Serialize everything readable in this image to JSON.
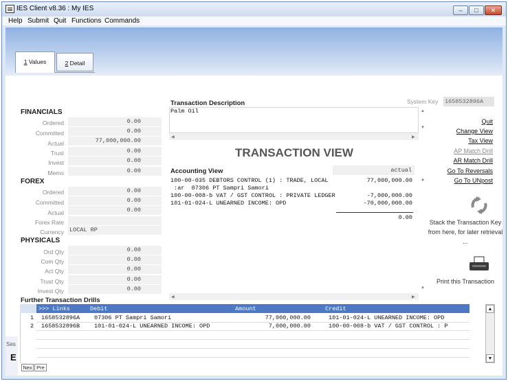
{
  "window": {
    "title": "IES Client v8.36 : My IES"
  },
  "menu": [
    "Help",
    "Submit",
    "Quit",
    "Functions",
    "Commands"
  ],
  "tabs": [
    {
      "label": "1 Values",
      "key": "1",
      "rest": " Values"
    },
    {
      "label": "2 Detail",
      "key": "2",
      "rest": " Detail"
    }
  ],
  "financials": {
    "heading": "FINANCIALS",
    "rows": [
      {
        "label": "Ordered",
        "value": "0.00"
      },
      {
        "label": "Committed",
        "value": "0.00"
      },
      {
        "label": "Actual",
        "value": "77,000,000.00"
      },
      {
        "label": "Trust",
        "value": "0.00"
      },
      {
        "label": "Invest",
        "value": "0.00"
      },
      {
        "label": "Memo",
        "value": "0.00"
      }
    ]
  },
  "forex": {
    "heading": "FOREX",
    "rows": [
      {
        "label": "Ordered",
        "value": "0.00"
      },
      {
        "label": "Committed",
        "value": "0.00"
      },
      {
        "label": "Actual",
        "value": "0.00"
      },
      {
        "label": "Forex Rate",
        "value": ""
      },
      {
        "label": "Currency",
        "value": "LOCAL RP"
      }
    ]
  },
  "physicals": {
    "heading": "PHYSICALS",
    "rows": [
      {
        "label": "Ord Qty",
        "value": "0.00"
      },
      {
        "label": "Com Qty",
        "value": "0.00"
      },
      {
        "label": "Act Qty",
        "value": "0.00"
      },
      {
        "label": "Trust Qty",
        "value": "0.00"
      },
      {
        "label": "Invest Qty",
        "value": "0.00"
      }
    ]
  },
  "description": {
    "label": "Transaction Description",
    "text": "Palm Oil"
  },
  "system_key": {
    "label": "System Key",
    "value": "1658532896A"
  },
  "view_title": "TRANSACTION VIEW",
  "accounting": {
    "label": "Accounting View",
    "column_head": "actual",
    "lines": [
      {
        "text": "100-00-035 DEBTORS CONTROL (1) : TRADE, LOCAL",
        "amount": "77,000,000.00"
      },
      {
        "text": " :ar  07306 PT Sampri Samori",
        "amount": ""
      },
      {
        "text": "100-00-008-b VAT / GST CONTROL : PRIVATE LEDGER",
        "amount": "-7,000,000.00"
      },
      {
        "text": "101-01-024-L UNEARNED INCOME: OPD",
        "amount": "-70,000,000.00"
      }
    ],
    "total": "0.00"
  },
  "actions": {
    "quit": "Quit",
    "change_view": "Change View",
    "tax_view": "Tax View",
    "ap_match": "AP Match Drill",
    "ar_match": "AR Match Drill",
    "go_reversals": "Go To Reversals",
    "go_unpost": "Go To UNpost",
    "stack_note": "Stack the Transaction Key from here, for later retrieval ...",
    "print_note": "Print this Transaction"
  },
  "drills": {
    "label": "Further Transaction Drills",
    "headers": {
      "links": ">>> Links",
      "debit": "Debit",
      "amount": "Amount",
      "credit": "Credit"
    },
    "rows": [
      {
        "num": "1",
        "link": "1658532896A",
        "debit": "07306 PT Sampri Samori",
        "amount": "77,000,000.00",
        "credit": "101-01-024-L UNEARNED INCOME: OPD"
      },
      {
        "num": "2",
        "link": "1658532896B",
        "debit": "101-01-024-L UNEARNED INCOME: OPD",
        "amount": "7,000,000.00",
        "credit": "100-00-008-b VAT / GST CONTROL : P"
      }
    ]
  },
  "nav": {
    "next": "Nex",
    "prev": "Pre"
  },
  "fragments": {
    "left_1": "Ses",
    "left_2": "E"
  }
}
